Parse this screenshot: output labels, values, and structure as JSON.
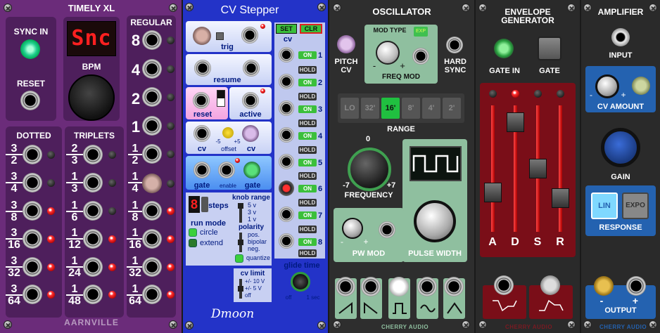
{
  "timely": {
    "title": "TIMELY XL",
    "sync_in": "SYNC IN",
    "reset": "RESET",
    "display": "Snc",
    "bpm": "BPM",
    "regular": "REGULAR",
    "regular_values": [
      "8",
      "4",
      "2",
      "1"
    ],
    "regular_fracs": [
      {
        "n": "1",
        "d": "2"
      },
      {
        "n": "1",
        "d": "4"
      },
      {
        "n": "1",
        "d": "8"
      },
      {
        "n": "1",
        "d": "16"
      },
      {
        "n": "1",
        "d": "32"
      },
      {
        "n": "1",
        "d": "64"
      }
    ],
    "dotted": "DOTTED",
    "dotted_fracs": [
      {
        "n": "3",
        "d": "2"
      },
      {
        "n": "3",
        "d": "4"
      },
      {
        "n": "3",
        "d": "8"
      },
      {
        "n": "3",
        "d": "16"
      },
      {
        "n": "3",
        "d": "32"
      },
      {
        "n": "3",
        "d": "64"
      }
    ],
    "triplets": "TRIPLETS",
    "triplet_fracs": [
      {
        "n": "2",
        "d": "3"
      },
      {
        "n": "1",
        "d": "3"
      },
      {
        "n": "1",
        "d": "6"
      },
      {
        "n": "1",
        "d": "12"
      },
      {
        "n": "1",
        "d": "24"
      },
      {
        "n": "1",
        "d": "48"
      }
    ],
    "brand": "AARNVILLE"
  },
  "stepper": {
    "title": "CV Stepper",
    "trig": "trig",
    "resume": "resume",
    "reset": "reset",
    "active": "active",
    "cv": "cv",
    "offset": "offset",
    "offset_min": "-5",
    "offset_max": "+5",
    "gate": "gate",
    "enable": "enable",
    "steps_value": "8",
    "steps": "steps",
    "run_mode": "run mode",
    "circle": "circle",
    "extend": "extend",
    "knob_range": "knob range",
    "range_5v": "5 v",
    "range_3v": "3 v",
    "range_1v": "1 v",
    "polarity": "polarity",
    "pos": "pos.",
    "bipolar": "bipolar",
    "neg": "neg.",
    "quantize": "quantize",
    "cv_limit": "cv limit",
    "limit_10": "+/- 10 V",
    "limit_5": "+/- 5 V",
    "limit_off": "off",
    "glide_time": "glide time",
    "glide_off": "off",
    "glide_1sec": "1 sec",
    "set": "SET",
    "clr": "CLR",
    "cv_col": "cv",
    "on": "ON",
    "hold": "HOLD",
    "step_nums": [
      "1",
      "2",
      "3",
      "4",
      "5",
      "6",
      "7",
      "8"
    ],
    "brand": "Dmoon"
  },
  "osc": {
    "title": "OSCILLATOR",
    "pitch_cv": "PITCH",
    "pitch_cv2": "CV",
    "mod_type": "MOD TYPE",
    "exp": "EXP",
    "freq_mod": "FREQ MOD",
    "minus": "-",
    "plus": "+",
    "hard_sync": "HARD",
    "hard_sync2": "SYNC",
    "range_buttons": [
      "LO",
      "32'",
      "16'",
      "8'",
      "4'",
      "2'"
    ],
    "range": "RANGE",
    "freq_zero": "0",
    "freq_min": "-7",
    "freq_max": "+7",
    "frequency": "FREQUENCY",
    "pw_mod": "PW MOD",
    "pulse_width": "PULSE WIDTH",
    "brand": "CHERRY AUDIO"
  },
  "env": {
    "title": "ENVELOPE",
    "title2": "GENERATOR",
    "gate_in": "GATE IN",
    "gate": "GATE",
    "sliders": [
      "A",
      "D",
      "S",
      "R"
    ],
    "brand": "CHERRY AUDIO"
  },
  "amp": {
    "title": "AMPLIFIER",
    "input": "INPUT",
    "cv_amount": "CV AMOUNT",
    "gain": "GAIN",
    "lin": "LIN",
    "expo": "EXPO",
    "response": "RESPONSE",
    "output": "OUTPUT",
    "minus": "-",
    "plus": "+",
    "brand": "CHERRY AUDIO"
  }
}
